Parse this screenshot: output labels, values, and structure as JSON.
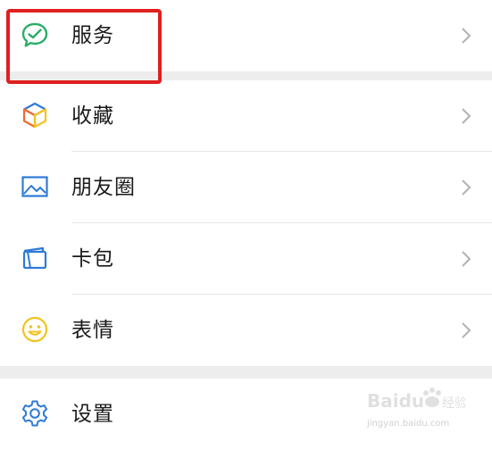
{
  "menu": {
    "items": [
      {
        "label": "服务",
        "icon": "wechat-pay-icon"
      },
      {
        "label": "收藏",
        "icon": "cube-icon"
      },
      {
        "label": "朋友圈",
        "icon": "photo-icon"
      },
      {
        "label": "卡包",
        "icon": "card-icon"
      },
      {
        "label": "表情",
        "icon": "smiley-icon"
      },
      {
        "label": "设置",
        "icon": "gear-icon"
      }
    ]
  },
  "watermark": {
    "text": "Baidu 经验",
    "sub": "jingyan.baidu.com"
  },
  "colors": {
    "highlight": "#e01f1f",
    "pay_green": "#2aae67",
    "link_blue": "#2f7ad8",
    "emoji_yellow": "#f2c320"
  }
}
